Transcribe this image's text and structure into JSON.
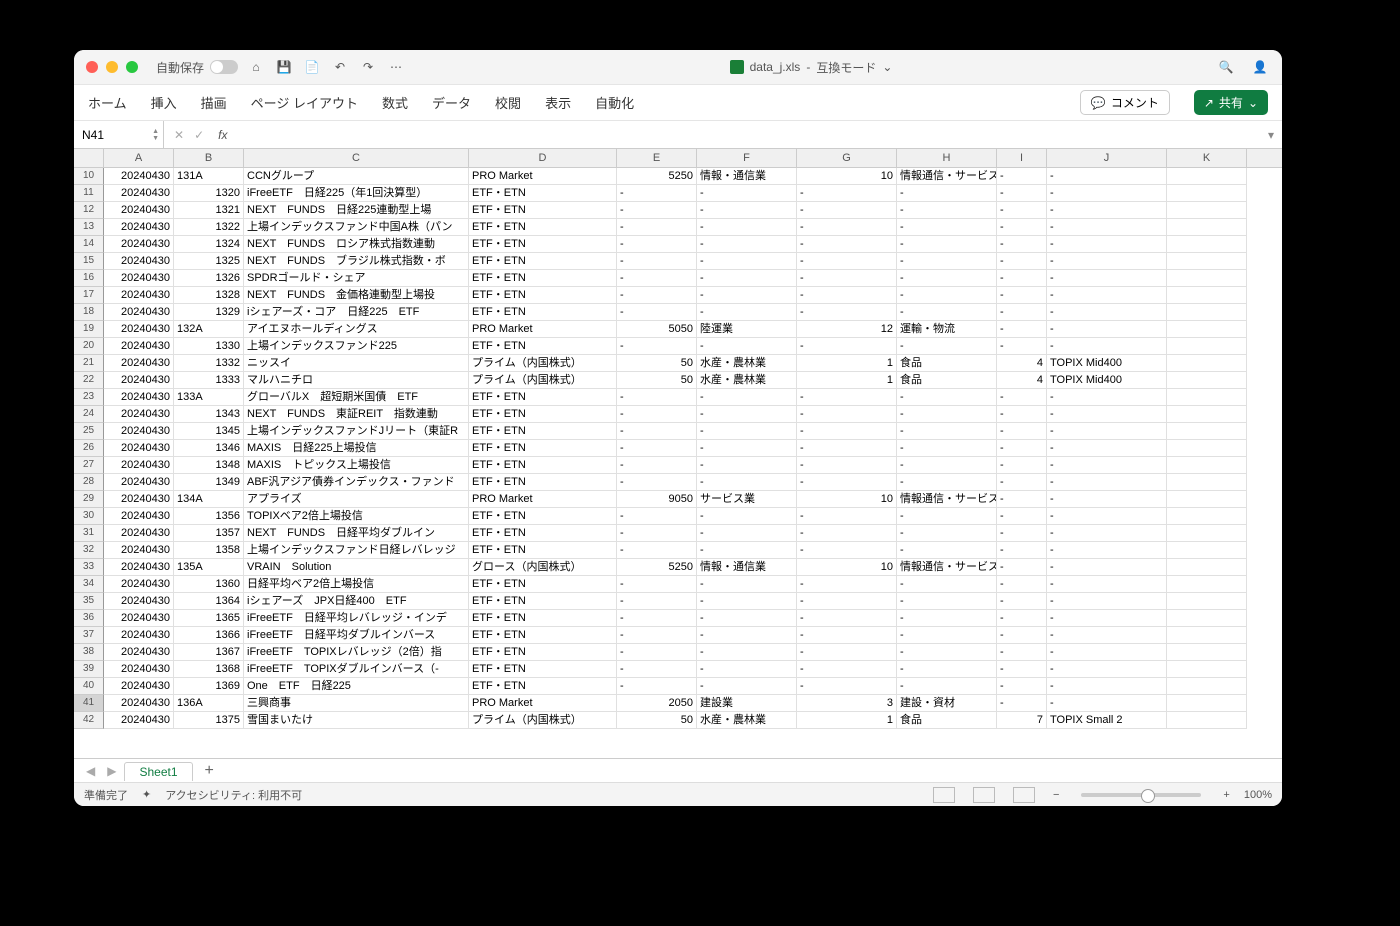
{
  "titlebar": {
    "autosave_label": "自動保存",
    "filename": "data_j.xls",
    "mode": "互換モード"
  },
  "ribbon": {
    "tabs": [
      "ホーム",
      "挿入",
      "描画",
      "ページ レイアウト",
      "数式",
      "データ",
      "校閲",
      "表示",
      "自動化"
    ],
    "comment": "コメント",
    "share": "共有"
  },
  "fbar": {
    "namebox": "N41",
    "fx": "fx"
  },
  "columns": [
    "A",
    "B",
    "C",
    "D",
    "E",
    "F",
    "G",
    "H",
    "I",
    "J",
    "K"
  ],
  "first_row_number": 10,
  "selected_row_number": 41,
  "rows": [
    {
      "A": "20240430",
      "B": "131A",
      "C": "CCNグループ",
      "D": "PRO Market",
      "E": "5250",
      "F": "情報・通信業",
      "G": "10",
      "H": "情報通信・サービス",
      "I": "-",
      "J": "-",
      "K": ""
    },
    {
      "A": "20240430",
      "B": "1320",
      "C": "iFreeETF　日経225（年1回決算型）",
      "D": "ETF・ETN",
      "E": "-",
      "F": "-",
      "G": "-",
      "H": "-",
      "I": "-",
      "J": "-",
      "K": ""
    },
    {
      "A": "20240430",
      "B": "1321",
      "C": "NEXT　FUNDS　日経225連動型上場",
      "D": "ETF・ETN",
      "E": "-",
      "F": "-",
      "G": "-",
      "H": "-",
      "I": "-",
      "J": "-",
      "K": ""
    },
    {
      "A": "20240430",
      "B": "1322",
      "C": "上場インデックスファンド中国A株（パン",
      "D": "ETF・ETN",
      "E": "-",
      "F": "-",
      "G": "-",
      "H": "-",
      "I": "-",
      "J": "-",
      "K": ""
    },
    {
      "A": "20240430",
      "B": "1324",
      "C": "NEXT　FUNDS　ロシア株式指数連動",
      "D": "ETF・ETN",
      "E": "-",
      "F": "-",
      "G": "-",
      "H": "-",
      "I": "-",
      "J": "-",
      "K": ""
    },
    {
      "A": "20240430",
      "B": "1325",
      "C": "NEXT　FUNDS　ブラジル株式指数・ボ",
      "D": "ETF・ETN",
      "E": "-",
      "F": "-",
      "G": "-",
      "H": "-",
      "I": "-",
      "J": "-",
      "K": ""
    },
    {
      "A": "20240430",
      "B": "1326",
      "C": "SPDRゴールド・シェア",
      "D": "ETF・ETN",
      "E": "-",
      "F": "-",
      "G": "-",
      "H": "-",
      "I": "-",
      "J": "-",
      "K": ""
    },
    {
      "A": "20240430",
      "B": "1328",
      "C": "NEXT　FUNDS　金価格連動型上場投",
      "D": "ETF・ETN",
      "E": "-",
      "F": "-",
      "G": "-",
      "H": "-",
      "I": "-",
      "J": "-",
      "K": ""
    },
    {
      "A": "20240430",
      "B": "1329",
      "C": "iシェアーズ・コア　日経225　ETF",
      "D": "ETF・ETN",
      "E": "-",
      "F": "-",
      "G": "-",
      "H": "-",
      "I": "-",
      "J": "-",
      "K": ""
    },
    {
      "A": "20240430",
      "B": "132A",
      "C": "アイエヌホールディングス",
      "D": "PRO Market",
      "E": "5050",
      "F": "陸運業",
      "G": "12",
      "H": "運輸・物流",
      "I": "-",
      "J": "-",
      "K": ""
    },
    {
      "A": "20240430",
      "B": "1330",
      "C": "上場インデックスファンド225",
      "D": "ETF・ETN",
      "E": "-",
      "F": "-",
      "G": "-",
      "H": "-",
      "I": "-",
      "J": "-",
      "K": ""
    },
    {
      "A": "20240430",
      "B": "1332",
      "C": "ニッスイ",
      "D": "プライム（内国株式）",
      "E": "50",
      "F": "水産・農林業",
      "G": "1",
      "H": "食品",
      "I": "4",
      "J": "TOPIX Mid400",
      "K": ""
    },
    {
      "A": "20240430",
      "B": "1333",
      "C": "マルハニチロ",
      "D": "プライム（内国株式）",
      "E": "50",
      "F": "水産・農林業",
      "G": "1",
      "H": "食品",
      "I": "4",
      "J": "TOPIX Mid400",
      "K": ""
    },
    {
      "A": "20240430",
      "B": "133A",
      "C": "グローバルX　超短期米国債　ETF",
      "D": "ETF・ETN",
      "E": "-",
      "F": "-",
      "G": "-",
      "H": "-",
      "I": "-",
      "J": "-",
      "K": ""
    },
    {
      "A": "20240430",
      "B": "1343",
      "C": "NEXT　FUNDS　東証REIT　指数連動",
      "D": "ETF・ETN",
      "E": "-",
      "F": "-",
      "G": "-",
      "H": "-",
      "I": "-",
      "J": "-",
      "K": ""
    },
    {
      "A": "20240430",
      "B": "1345",
      "C": "上場インデックスファンドJリート（東証R",
      "D": "ETF・ETN",
      "E": "-",
      "F": "-",
      "G": "-",
      "H": "-",
      "I": "-",
      "J": "-",
      "K": ""
    },
    {
      "A": "20240430",
      "B": "1346",
      "C": "MAXIS　日経225上場投信",
      "D": "ETF・ETN",
      "E": "-",
      "F": "-",
      "G": "-",
      "H": "-",
      "I": "-",
      "J": "-",
      "K": ""
    },
    {
      "A": "20240430",
      "B": "1348",
      "C": "MAXIS　トピックス上場投信",
      "D": "ETF・ETN",
      "E": "-",
      "F": "-",
      "G": "-",
      "H": "-",
      "I": "-",
      "J": "-",
      "K": ""
    },
    {
      "A": "20240430",
      "B": "1349",
      "C": "ABF汎アジア債券インデックス・ファンド",
      "D": "ETF・ETN",
      "E": "-",
      "F": "-",
      "G": "-",
      "H": "-",
      "I": "-",
      "J": "-",
      "K": ""
    },
    {
      "A": "20240430",
      "B": "134A",
      "C": "アプライズ",
      "D": "PRO Market",
      "E": "9050",
      "F": "サービス業",
      "G": "10",
      "H": "情報通信・サービス",
      "I": "-",
      "J": "-",
      "K": ""
    },
    {
      "A": "20240430",
      "B": "1356",
      "C": "TOPIXベア2倍上場投信",
      "D": "ETF・ETN",
      "E": "-",
      "F": "-",
      "G": "-",
      "H": "-",
      "I": "-",
      "J": "-",
      "K": ""
    },
    {
      "A": "20240430",
      "B": "1357",
      "C": "NEXT　FUNDS　日経平均ダブルイン",
      "D": "ETF・ETN",
      "E": "-",
      "F": "-",
      "G": "-",
      "H": "-",
      "I": "-",
      "J": "-",
      "K": ""
    },
    {
      "A": "20240430",
      "B": "1358",
      "C": "上場インデックスファンド日経レバレッジ",
      "D": "ETF・ETN",
      "E": "-",
      "F": "-",
      "G": "-",
      "H": "-",
      "I": "-",
      "J": "-",
      "K": ""
    },
    {
      "A": "20240430",
      "B": "135A",
      "C": "VRAIN　Solution",
      "D": "グロース（内国株式）",
      "E": "5250",
      "F": "情報・通信業",
      "G": "10",
      "H": "情報通信・サービス",
      "I": "-",
      "J": "-",
      "K": ""
    },
    {
      "A": "20240430",
      "B": "1360",
      "C": "日経平均ベア2倍上場投信",
      "D": "ETF・ETN",
      "E": "-",
      "F": "-",
      "G": "-",
      "H": "-",
      "I": "-",
      "J": "-",
      "K": ""
    },
    {
      "A": "20240430",
      "B": "1364",
      "C": "iシェアーズ　JPX日経400　ETF",
      "D": "ETF・ETN",
      "E": "-",
      "F": "-",
      "G": "-",
      "H": "-",
      "I": "-",
      "J": "-",
      "K": ""
    },
    {
      "A": "20240430",
      "B": "1365",
      "C": "iFreeETF　日経平均レバレッジ・インデ",
      "D": "ETF・ETN",
      "E": "-",
      "F": "-",
      "G": "-",
      "H": "-",
      "I": "-",
      "J": "-",
      "K": ""
    },
    {
      "A": "20240430",
      "B": "1366",
      "C": "iFreeETF　日経平均ダブルインバース",
      "D": "ETF・ETN",
      "E": "-",
      "F": "-",
      "G": "-",
      "H": "-",
      "I": "-",
      "J": "-",
      "K": ""
    },
    {
      "A": "20240430",
      "B": "1367",
      "C": "iFreeETF　TOPIXレバレッジ（2倍）指",
      "D": "ETF・ETN",
      "E": "-",
      "F": "-",
      "G": "-",
      "H": "-",
      "I": "-",
      "J": "-",
      "K": ""
    },
    {
      "A": "20240430",
      "B": "1368",
      "C": "iFreeETF　TOPIXダブルインバース（-",
      "D": "ETF・ETN",
      "E": "-",
      "F": "-",
      "G": "-",
      "H": "-",
      "I": "-",
      "J": "-",
      "K": ""
    },
    {
      "A": "20240430",
      "B": "1369",
      "C": "One　ETF　日経225",
      "D": "ETF・ETN",
      "E": "-",
      "F": "-",
      "G": "-",
      "H": "-",
      "I": "-",
      "J": "-",
      "K": ""
    },
    {
      "A": "20240430",
      "B": "136A",
      "C": "三興商事",
      "D": "PRO Market",
      "E": "2050",
      "F": "建設業",
      "G": "3",
      "H": "建設・資材",
      "I": "-",
      "J": "-",
      "K": ""
    },
    {
      "A": "20240430",
      "B": "1375",
      "C": "雪国まいたけ",
      "D": "プライム（内国株式）",
      "E": "50",
      "F": "水産・農林業",
      "G": "1",
      "H": "食品",
      "I": "7",
      "J": "TOPIX Small 2",
      "K": ""
    }
  ],
  "sheet": {
    "name": "Sheet1"
  },
  "status": {
    "ready": "準備完了",
    "a11y": "アクセシビリティ: 利用不可",
    "zoom": "100%"
  }
}
